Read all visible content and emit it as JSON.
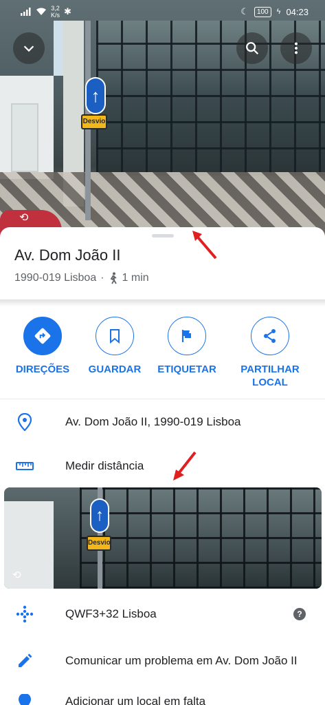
{
  "status_bar": {
    "speed_value": "3,2",
    "speed_unit": "K/s",
    "battery": "100",
    "time": "04:23"
  },
  "street_view": {
    "sign_label": "Desvio",
    "thumbnail_sign_label": "Desvio"
  },
  "place": {
    "title": "Av. Dom João II",
    "postal_city": "1990-019 Lisboa",
    "separator": "·",
    "walk_time": "1 min"
  },
  "actions": [
    {
      "label": "DIREÇÕES",
      "icon": "directions-icon"
    },
    {
      "label": "GUARDAR",
      "icon": "bookmark-icon"
    },
    {
      "label": "ETIQUETAR",
      "icon": "flag-icon"
    },
    {
      "label": "PARTILHAR LOCAL",
      "icon": "share-icon"
    }
  ],
  "details": {
    "address": "Av. Dom João II, 1990-019 Lisboa",
    "measure_distance": "Medir distância",
    "plus_code": "QWF3+32 Lisboa",
    "report_problem": "Comunicar um problema em Av. Dom João II",
    "add_missing": "Adicionar um local em falta"
  },
  "colors": {
    "accent": "#1a73e8",
    "annotation_arrow": "#e02020"
  }
}
